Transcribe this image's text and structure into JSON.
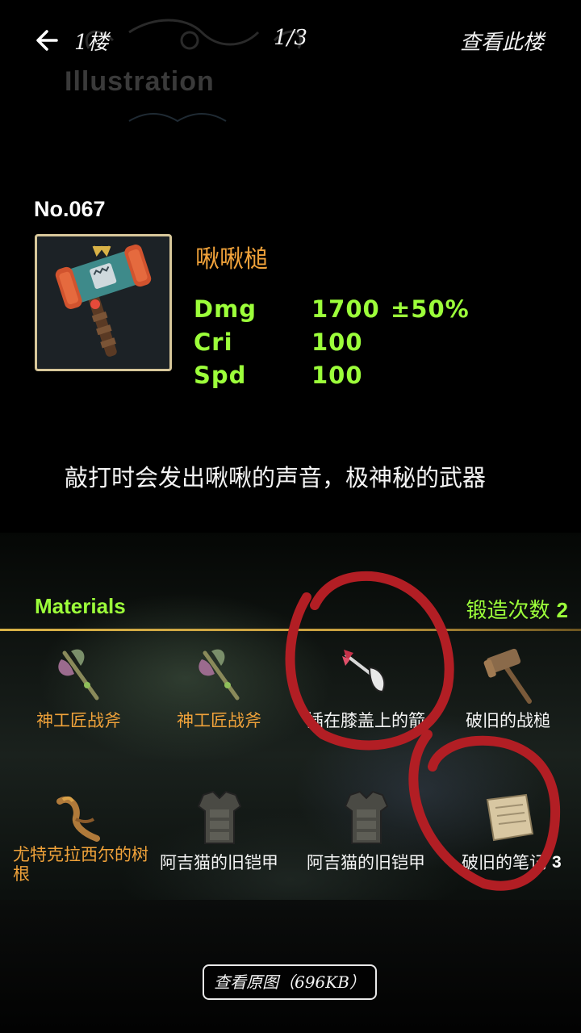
{
  "topbar": {
    "back_icon": "arrow-left-icon",
    "floor": "1楼",
    "page": "1/3",
    "view_floor": "查看此楼"
  },
  "header": {
    "section_title": "Illustration"
  },
  "item": {
    "number": "No.067",
    "name": "啾啾槌",
    "stats": [
      {
        "name": "Dmg",
        "value": "1700",
        "variance": "±50%"
      },
      {
        "name": "Cri",
        "value": "100",
        "variance": ""
      },
      {
        "name": "Spd",
        "value": "100",
        "variance": ""
      }
    ],
    "description": "敲打时会发出啾啾的声音，极神秘的武器"
  },
  "materials": {
    "title": "Materials",
    "forge_label": "锻造次数",
    "forge_count": "2",
    "items": [
      {
        "name": "神工匠战斧",
        "icon": "battle-axe-icon"
      },
      {
        "name": "神工匠战斧",
        "icon": "battle-axe-icon"
      },
      {
        "name": "插在膝盖上的箭",
        "icon": "arrow-icon"
      },
      {
        "name": "破旧的战槌",
        "icon": "war-hammer-icon"
      },
      {
        "name": "尤特克拉西尔的树根",
        "icon": "tree-root-icon"
      },
      {
        "name": "阿吉猫的旧铠甲",
        "icon": "armor-icon"
      },
      {
        "name": "阿吉猫的旧铠甲",
        "icon": "armor-icon"
      },
      {
        "name": "破旧的笔记",
        "icon": "scroll-icon",
        "count": "3"
      }
    ]
  },
  "footer": {
    "view_original": "查看原图（696KB）"
  },
  "colors": {
    "green": "#9cff3a",
    "orange": "#f0a23a",
    "gold": "#d9b247",
    "annotation": "#b21e24"
  }
}
